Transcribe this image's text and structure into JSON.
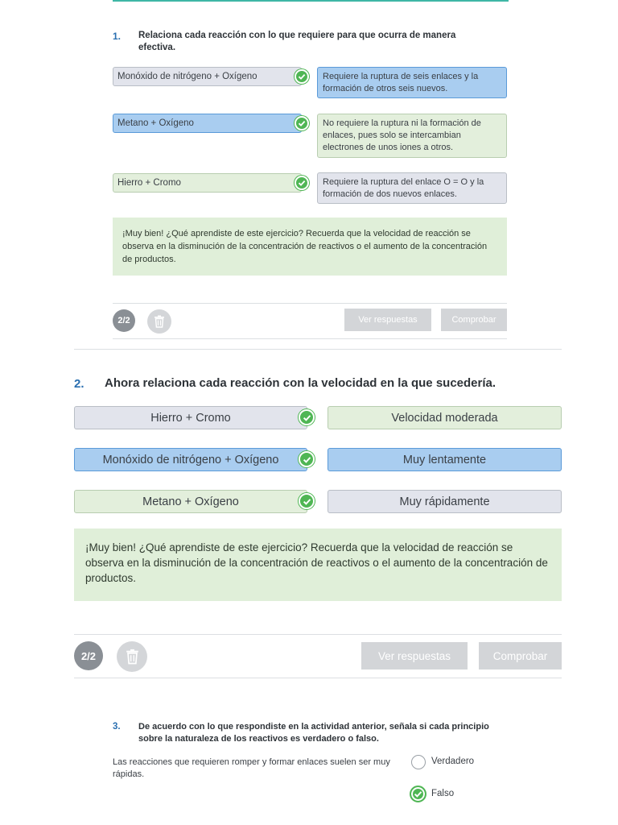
{
  "q1": {
    "number": "1.",
    "text": "Relaciona cada reacción con lo que requiere para que ocurra de manera efectiva.",
    "pairs": [
      {
        "left": "Monóxido de nitrógeno + Oxígeno",
        "right": "Requiere la ruptura de seis enlaces y la formación de otros seis nuevos."
      },
      {
        "left": "Metano + Oxígeno",
        "right": "No requiere la ruptura ni la formación de enlaces, pues solo se intercambian electrones de unos iones a otros."
      },
      {
        "left": "Hierro + Cromo",
        "right": "Requiere la ruptura del enlace O = O y la formación de dos nuevos enlaces."
      }
    ],
    "feedback": "¡Muy bien! ¿Qué aprendiste de este ejercicio? Recuerda que la velocidad de reacción se observa en la disminución de la concentración de reactivos o el aumento de la concentración de productos.",
    "counter": "2/2",
    "btn_answers": "Ver respuestas",
    "btn_check": "Comprobar"
  },
  "q2": {
    "number": "2.",
    "text": "Ahora relaciona cada reacción con la velocidad en la que sucedería.",
    "pairs": [
      {
        "left": "Hierro + Cromo",
        "right": "Velocidad moderada"
      },
      {
        "left": "Monóxido de nitrógeno + Oxígeno",
        "right": "Muy lentamente"
      },
      {
        "left": "Metano + Oxígeno",
        "right": "Muy rápidamente"
      }
    ],
    "feedback": "¡Muy bien! ¿Qué aprendiste de este ejercicio? Recuerda que la velocidad de reacción se observa en la disminución de la concentración de reactivos o el aumento de la concentración de productos.",
    "counter": "2/2",
    "btn_answers": "Ver respuestas",
    "btn_check": "Comprobar"
  },
  "q3": {
    "number": "3.",
    "text": "De acuerdo con lo que respondiste en la actividad anterior, señala si cada principio sobre la naturaleza de los reactivos es verdadero o falso.",
    "statement": "Las reacciones que requieren romper y formar enlaces suelen ser muy rápidas.",
    "options": [
      "Verdadero",
      "Falso"
    ],
    "selected": "Falso"
  },
  "colors": {
    "teal_rule": "#3fb7a6",
    "question_number": "#2a6fb0",
    "check_green": "#4fb654",
    "pill_blue": "#a9cdf0",
    "pill_green": "#e3efdc",
    "pill_gray": "#e2e4ec",
    "feedback_bg": "#e0efd9",
    "button_disabled": "#d3d5d8"
  },
  "icons": [
    "check-icon",
    "trash-icon",
    "radio-checked-icon"
  ]
}
